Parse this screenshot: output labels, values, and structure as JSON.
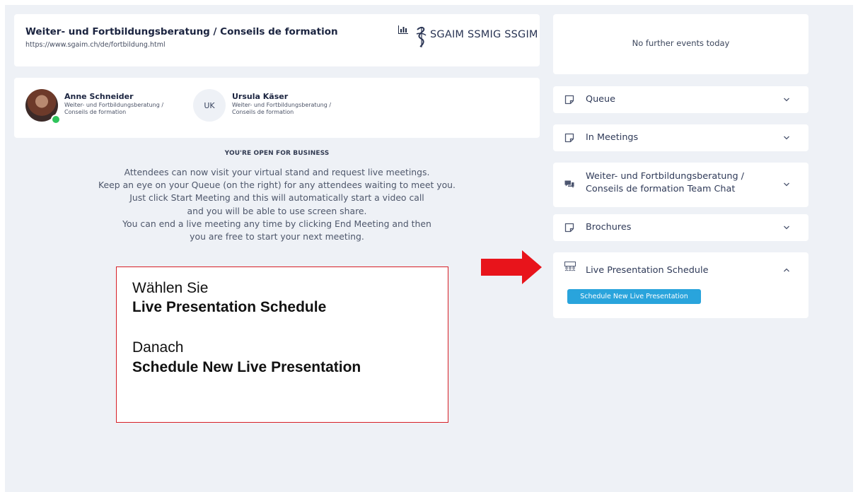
{
  "header": {
    "title": "Weiter- und Fortbildungsberatung / Conseils de formation",
    "url": "https://www.sgaim.ch/de/fortbildung.html",
    "logo_text": "SGAIM SSMIG SSGIM"
  },
  "people": [
    {
      "name": "Anne Schneider",
      "org": "Weiter- und Fortbildungsberatung / Conseils de formation",
      "status": "online"
    },
    {
      "initials": "UK",
      "name": "Ursula Käser",
      "org": "Weiter- und Fortbildungsberatung / Conseils de formation"
    }
  ],
  "status_title": "YOU'RE OPEN FOR BUSINESS",
  "instructions": [
    "Attendees can now visit your virtual stand and request live meetings.",
    "Keep an eye on your Queue (on the right) for any attendees waiting to meet you.",
    "Just click Start Meeting and this will automatically start a video call",
    "and you will be able to use screen share.",
    "You can end a live meeting any time by clicking End Meeting and then",
    "you are free to start your next meeting."
  ],
  "annotation": {
    "line1": "Wählen Sie",
    "line2": "Live Presentation Schedule",
    "line3": "Danach",
    "line4": "Schedule New Live Presentation"
  },
  "events_text": "No further events today",
  "accordions": [
    {
      "label": "Queue",
      "icon": "note-icon",
      "expanded": false
    },
    {
      "label": "In Meetings",
      "icon": "note-icon",
      "expanded": false
    },
    {
      "label_line1": "Weiter- und Fortbildungsberatung /",
      "label_line2": "Conseils de formation Team Chat",
      "icon": "chat-icon",
      "expanded": false
    },
    {
      "label": "Brochures",
      "icon": "note-icon",
      "expanded": false
    },
    {
      "label": "Live Presentation Schedule",
      "icon": "presentation-icon",
      "expanded": true,
      "button_label": "Schedule New Live Presentation"
    }
  ],
  "colors": {
    "background": "#eef1f6",
    "card": "#ffffff",
    "primary_button": "#29a4dc",
    "online": "#2ec45b",
    "annotation_border": "#d61f26",
    "arrow": "#e8141b"
  }
}
